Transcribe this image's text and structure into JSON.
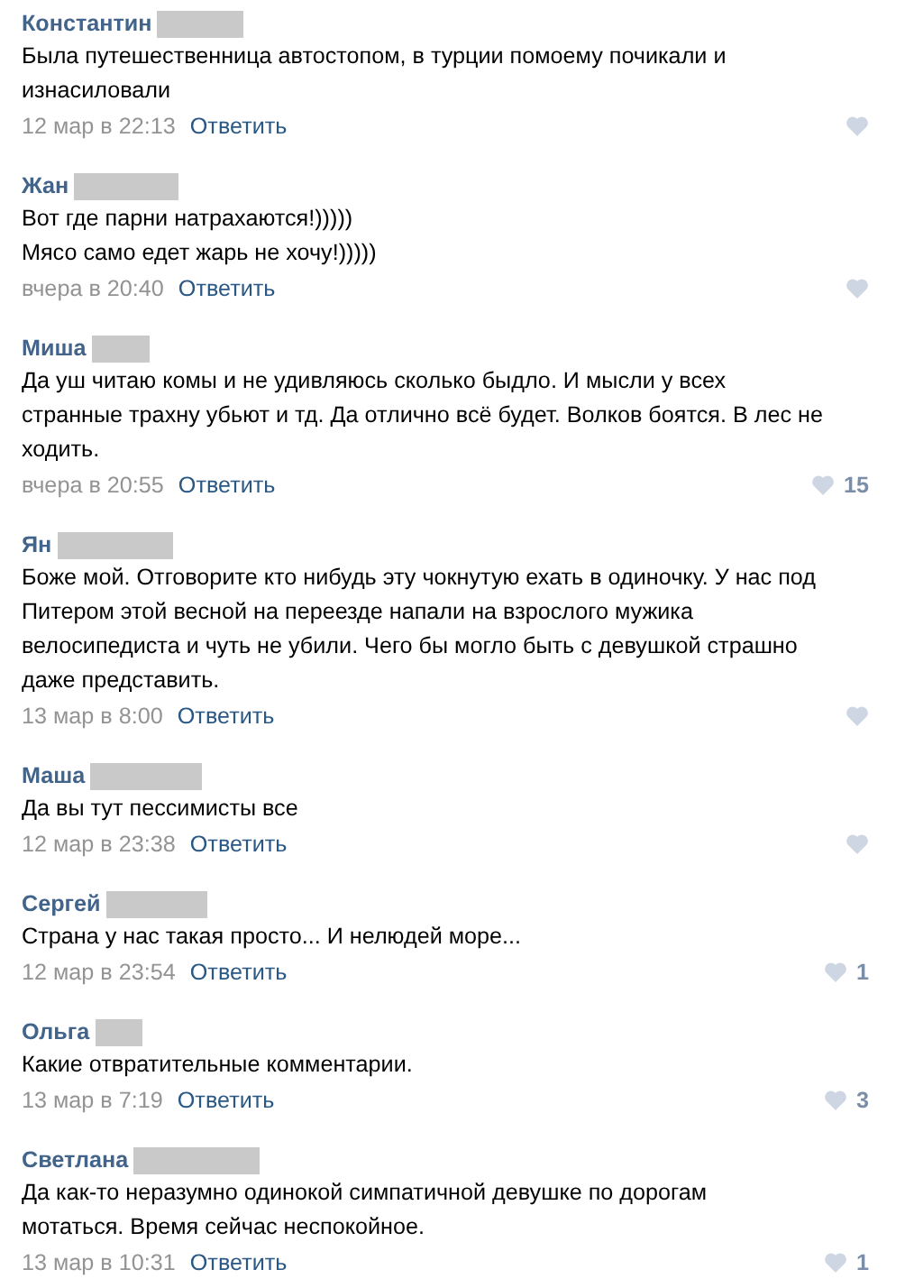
{
  "comments": [
    {
      "author": "Константин",
      "lines": [
        "Была путешественница автостопом, в турции помоему почикали и",
        "изнасиловали"
      ],
      "time": "12 мар в 22:13",
      "reply": "Ответить"
    },
    {
      "author": "Жан",
      "lines": [
        "Вот где парни натрахаются!)))))",
        "Мясо само едет жарь не хочу!)))))"
      ],
      "time": "вчера в 20:40",
      "reply": "Ответить"
    },
    {
      "author": "Миша",
      "lines": [
        "Да уш читаю комы и не удивляюсь сколько быдло. И мысли у всех",
        "странные трахну убьют и тд. Да отлично всё будет. Волков боятся. В лес не",
        "ходить."
      ],
      "time": "вчера в 20:55",
      "reply": "Ответить",
      "likes": "15"
    },
    {
      "author": "Ян",
      "lines": [
        "Боже мой. Отговорите кто нибудь эту чокнутую ехать в одиночку. У нас под",
        "Питером этой весной на переезде напали на взрослого мужика",
        "велосипедиста и чуть не убили. Чего бы могло быть с девушкой страшно",
        "даже представить."
      ],
      "time": "13 мар в 8:00",
      "reply": "Ответить"
    },
    {
      "author": "Маша",
      "lines": [
        "Да вы тут пессимисты все"
      ],
      "time": "12 мар в 23:38",
      "reply": "Ответить"
    },
    {
      "author": "Сергей",
      "lines": [
        "Страна у нас такая просто... И нелюдей море..."
      ],
      "time": "12 мар в 23:54",
      "reply": "Ответить",
      "likes": "1"
    },
    {
      "author": "Ольга",
      "lines": [
        "Какие отвратительные комментарии."
      ],
      "time": "13 мар в 7:19",
      "reply": "Ответить",
      "likes": "3"
    },
    {
      "author": "Светлана",
      "lines": [
        "Да как-то неразумно одинокой симпатичной девушке по дорогам",
        "мотаться. Время сейчас неспокойное."
      ],
      "time": "13 мар в 10:31",
      "reply": "Ответить",
      "likes": "1"
    }
  ]
}
